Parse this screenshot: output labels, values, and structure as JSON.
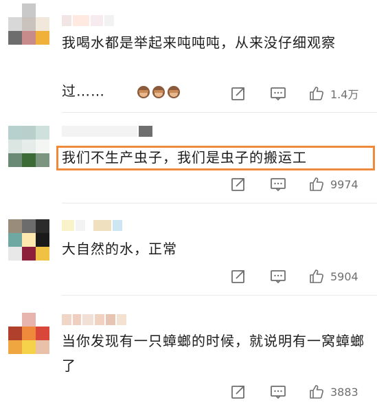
{
  "comments": [
    {
      "text": "我喝水都是举起来吨吨吨，从来没仔细观察过……",
      "emoji_names": [
        "see-no-evil-monkey",
        "see-no-evil-monkey",
        "see-no-evil-monkey"
      ],
      "likes": "1.4万",
      "avatar_colors": [
        "#ffffff",
        "#c9c9c9",
        "#ffffff",
        "#d8d8d8",
        "#c9c2bd",
        "#f1e7da",
        "#6d6d6d",
        "#c88b8b",
        "#f0b13a"
      ],
      "name_colors": [
        "#f2e6e4",
        "#ffe9e0",
        "#f6ecf0",
        "#f2f2f2"
      ]
    },
    {
      "text": "我们不生产虫子，我们是虫子的搬运工",
      "likes": "9974",
      "avatar_colors": [
        "#b7d1cf",
        "#b9cfcc",
        "#cfe1dd",
        "#dbe6e2",
        "#e5ecea",
        "#f4f6f4",
        "#6b8a75",
        "#3d6b38",
        "#7c957f"
      ],
      "name_colors": [
        "#f3f3f3",
        "#6f6f6f"
      ]
    },
    {
      "text": "大自然的水，正常",
      "likes": "5904",
      "avatar_colors": [
        "#9a8c7a",
        "#6c6c6c",
        "#2b2b2b",
        "#6fa7a2",
        "#fde9b0",
        "#1a1a1a",
        "#e8e8e8",
        "#8d1f3a",
        "#f0c244"
      ],
      "name_colors": [
        "#f9f3c9",
        "#f3f3f3",
        "#ffffff",
        "#efe0bf",
        "#cde6f2"
      ]
    },
    {
      "text": "当你发现有一只蟑螂的时候，就说明有一窝蟑螂了",
      "likes": "3883",
      "avatar_colors": [
        "#ffffff",
        "#e8b4ae",
        "#ffffff",
        "#b0402b",
        "#ef8a3c",
        "#d9473a",
        "#f0a640",
        "#f6d24a",
        "#e9c0a8"
      ],
      "name_colors": [
        "#f0d6c6",
        "#f0cfc0",
        "#f2dfd6",
        "#f1d2c0",
        "#e8c5b2",
        "#f3e2d2"
      ]
    }
  ],
  "icons": {
    "share": "share-icon",
    "reply": "comment-icon",
    "like": "thumbs-up-icon"
  },
  "accent": "#ef8a3c"
}
